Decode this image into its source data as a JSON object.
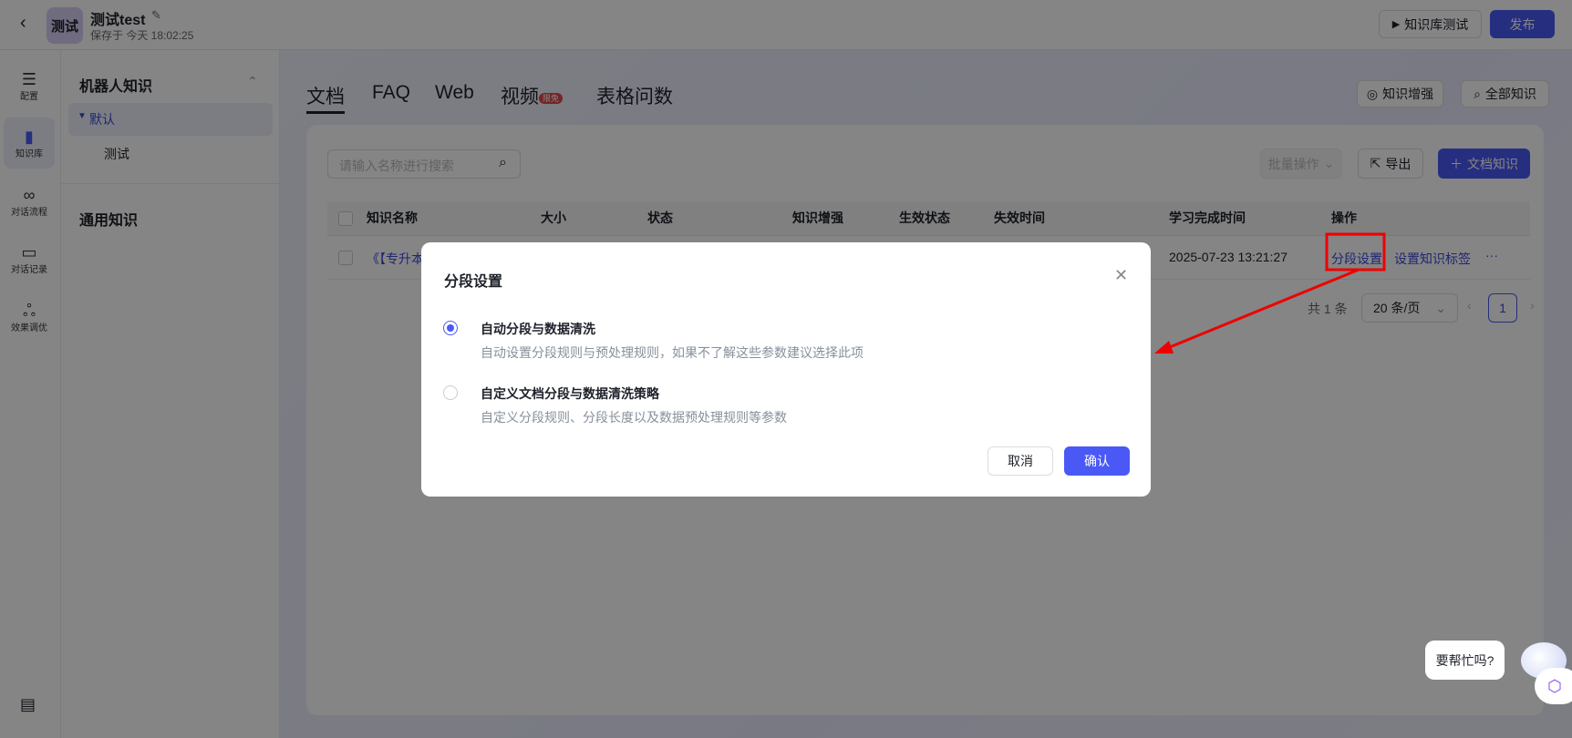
{
  "header": {
    "app_avatar": "测试",
    "title": "测试test",
    "saved": "保存于 今天 18:02:25",
    "test_button": "知识库测试",
    "publish_button": "发布"
  },
  "rail": [
    {
      "label": "配置",
      "icon": "sliders-icon"
    },
    {
      "label": "知识库",
      "icon": "book-icon"
    },
    {
      "label": "对话流程",
      "icon": "flow-icon"
    },
    {
      "label": "对话记录",
      "icon": "chat-icon"
    },
    {
      "label": "效果调优",
      "icon": "circles-icon"
    }
  ],
  "sidebar": {
    "robot_knowledge": "机器人知识",
    "default_group": "默认",
    "sub_item": "测试",
    "general_knowledge": "通用知识"
  },
  "tabs": [
    {
      "label": "文档"
    },
    {
      "label": "FAQ"
    },
    {
      "label": "Web"
    },
    {
      "label": "视频",
      "badge": "限免"
    },
    {
      "label": "表格问数"
    }
  ],
  "toolbar": {
    "enhance": "知识增强",
    "all_knowledge": "全部知识",
    "search_placeholder": "请输入名称进行搜索",
    "batch": "批量操作",
    "export": "导出",
    "add_doc": "文档知识"
  },
  "table": {
    "columns": [
      "知识名称",
      "大小",
      "状态",
      "知识增强",
      "生效状态",
      "失效时间",
      "学习完成时间",
      "操作"
    ],
    "rows": [
      {
        "name": "《【专升本",
        "learned_at": "2025-07-23 13:21:27",
        "actions": [
          "分段设置",
          "设置知识标签",
          "···"
        ]
      }
    ]
  },
  "pagination": {
    "total": "共 1 条",
    "page_size": "20 条/页",
    "current": "1"
  },
  "modal": {
    "title": "分段设置",
    "options": [
      {
        "title": "自动分段与数据清洗",
        "desc": "自动设置分段规则与预处理规则，如果不了解这些参数建议选择此项",
        "selected": true
      },
      {
        "title": "自定义文档分段与数据清洗策略",
        "desc": "自定义分段规则、分段长度以及数据预处理规则等参数",
        "selected": false
      }
    ],
    "cancel": "取消",
    "confirm": "确认"
  },
  "help": {
    "bubble": "要帮忙吗?"
  },
  "colors": {
    "primary": "#4a59f5",
    "annotation": "#ee0000"
  }
}
